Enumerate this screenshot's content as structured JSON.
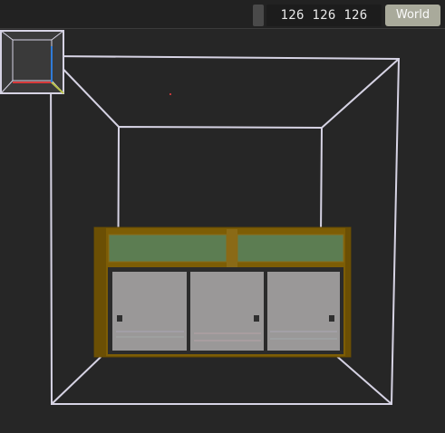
{
  "toolbar": {
    "dimensions": "126 126 126",
    "space_label": "World"
  },
  "colors": {
    "background": "#262626",
    "wireframe": "#d6d3e4",
    "cabinet_frame": "#7d5d05",
    "cabinet_panel": "#5c7d52",
    "cabinet_door": "#9a9898",
    "gizmo_x_axis": "#d83a3a",
    "gizmo_y_axis": "#b9c24a",
    "gizmo_z_axis": "#2f7bd8"
  },
  "scene": {
    "objects": [
      "room-wireframe-box",
      "cabinet"
    ],
    "cabinet_door_count": 3,
    "cabinet_upper_panel_count": 2
  }
}
